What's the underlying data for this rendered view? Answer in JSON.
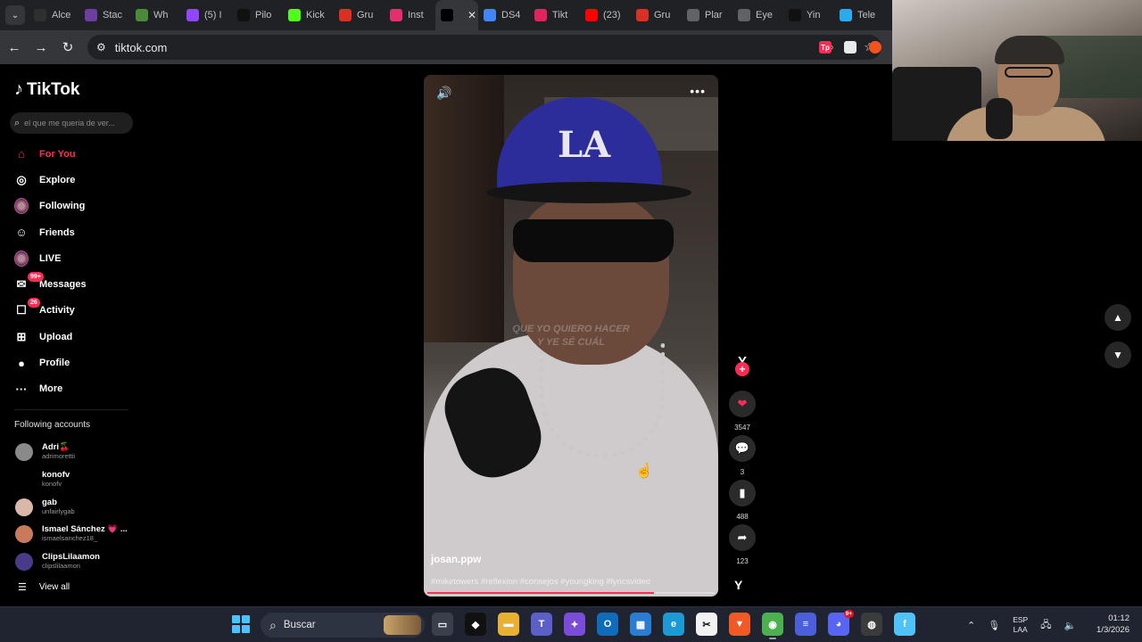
{
  "browser": {
    "tabs": [
      {
        "label": "Alce",
        "icon": "notion-icon",
        "color": "#2f2f2f"
      },
      {
        "label": "Stac",
        "icon": "stack-icon",
        "color": "#6b3fa0"
      },
      {
        "label": "Wh",
        "icon": "whatsapp-icon",
        "color": "#4a8a3a"
      },
      {
        "label": "(5) I",
        "icon": "twitch-icon",
        "color": "#9146ff"
      },
      {
        "label": "Pilo",
        "icon": "pilot-icon",
        "color": "#111111"
      },
      {
        "label": "Kick",
        "icon": "kick-icon",
        "color": "#53fc18"
      },
      {
        "label": "Gru",
        "icon": "gmail-icon",
        "color": "#d93025"
      },
      {
        "label": "Inst",
        "icon": "instagram-icon",
        "color": "#e1306c"
      },
      {
        "label": "",
        "icon": "tiktok-icon",
        "color": "#000000",
        "active": true
      },
      {
        "label": "DS4",
        "icon": "docs-icon",
        "color": "#4285f4"
      },
      {
        "label": "Tikt",
        "icon": "tiktok-tool-icon",
        "color": "#e0245e"
      },
      {
        "label": "(23)",
        "icon": "youtube-icon",
        "color": "#ff0000"
      },
      {
        "label": "Gru",
        "icon": "gmail-icon",
        "color": "#d93025"
      },
      {
        "label": "Plar",
        "icon": "globe-icon",
        "color": "#5f6368"
      },
      {
        "label": "Eye",
        "icon": "globe-icon",
        "color": "#5f6368"
      },
      {
        "label": "Yin",
        "icon": "y-icon",
        "color": "#111111"
      },
      {
        "label": "Tele",
        "icon": "telegram-icon",
        "color": "#2aabee"
      }
    ],
    "url": "tiktok.com"
  },
  "sidebar": {
    "brand": "TikTok",
    "search_placeholder": "el que me queria de ver...",
    "nav": [
      {
        "label": "For You",
        "icon": "home-icon",
        "glyph": "⌂",
        "active": true
      },
      {
        "label": "Explore",
        "icon": "compass-icon",
        "glyph": "◎"
      },
      {
        "label": "Following",
        "icon": "following-avatar-icon",
        "glyph": "avatar"
      },
      {
        "label": "Friends",
        "icon": "friends-icon",
        "glyph": "☺"
      },
      {
        "label": "LIVE",
        "icon": "live-avatar-icon",
        "glyph": "avatar"
      },
      {
        "label": "Messages",
        "icon": "messages-icon",
        "glyph": "✉",
        "badge": "99+"
      },
      {
        "label": "Activity",
        "icon": "activity-icon",
        "glyph": "☐",
        "badge": "26"
      },
      {
        "label": "Upload",
        "icon": "upload-icon",
        "glyph": "⊞"
      },
      {
        "label": "Profile",
        "icon": "profile-icon",
        "glyph": "●"
      },
      {
        "label": "More",
        "icon": "more-icon",
        "glyph": "···"
      }
    ],
    "following_title": "Following accounts",
    "following": [
      {
        "name": "Adri🍒",
        "handle": "adrimorettii",
        "color": "#8a8a8a"
      },
      {
        "name": "konofv",
        "handle": "konofv",
        "color": "#000000"
      },
      {
        "name": "gab",
        "handle": "unfairlygab",
        "color": "#d9b8a8"
      },
      {
        "name": "Ismael Sánchez 💗 ...",
        "handle": "ismaelsanchez18_",
        "color": "#c87a5a"
      },
      {
        "name": "ClipsLilaamon",
        "handle": "clipslilaamon",
        "color": "#4a3a8a"
      }
    ],
    "view_all": "View all"
  },
  "video": {
    "author": "josan.ppw",
    "hashtags": "#miketowers #reflexion #consejos #youngking #lyricsvideo",
    "subtitle_line1": "QUE YO QUIERO HACER",
    "subtitle_line2": "Y YE SÉ CUÁL",
    "cap_logo": "LA",
    "progress": 0.79
  },
  "actions": {
    "likes": "3547",
    "comments": "3",
    "saves": "488",
    "shares": "123"
  },
  "taskbar": {
    "search_label": "Buscar",
    "apps": [
      {
        "name": "task-view-icon",
        "color": "#3a3f4b",
        "glyph": "▭"
      },
      {
        "name": "epic-games-icon",
        "color": "#111111",
        "glyph": "◆"
      },
      {
        "name": "file-explorer-icon",
        "color": "#e8b230",
        "glyph": "▬"
      },
      {
        "name": "teams-icon",
        "color": "#5b5fc7",
        "glyph": "T"
      },
      {
        "name": "copilot-icon",
        "color": "#7a4cd9",
        "glyph": "✦"
      },
      {
        "name": "outlook-icon",
        "color": "#0f6cbd",
        "glyph": "O"
      },
      {
        "name": "store-icon",
        "color": "#2b7cd3",
        "glyph": "▦"
      },
      {
        "name": "edge-icon",
        "color": "#1c9ad6",
        "glyph": "e"
      },
      {
        "name": "capcut-icon",
        "color": "#f2f2f2",
        "glyph": "✂"
      },
      {
        "name": "brave-icon",
        "color": "#f15a24",
        "glyph": "▼"
      },
      {
        "name": "chrome-icon",
        "color": "#4caf50",
        "glyph": "◉"
      },
      {
        "name": "notes-icon",
        "color": "#4a5fd9",
        "glyph": "≡"
      },
      {
        "name": "discord-icon",
        "color": "#5865f2",
        "glyph": "◕",
        "badge": "9+"
      },
      {
        "name": "obs-icon",
        "color": "#3b3b3b",
        "glyph": "◍"
      },
      {
        "name": "file-app-icon",
        "color": "#4fc3f7",
        "glyph": "f"
      }
    ],
    "lang_top": "ESP",
    "lang_bottom": "LAA",
    "time": "01:12",
    "date": "1/3/2026"
  }
}
